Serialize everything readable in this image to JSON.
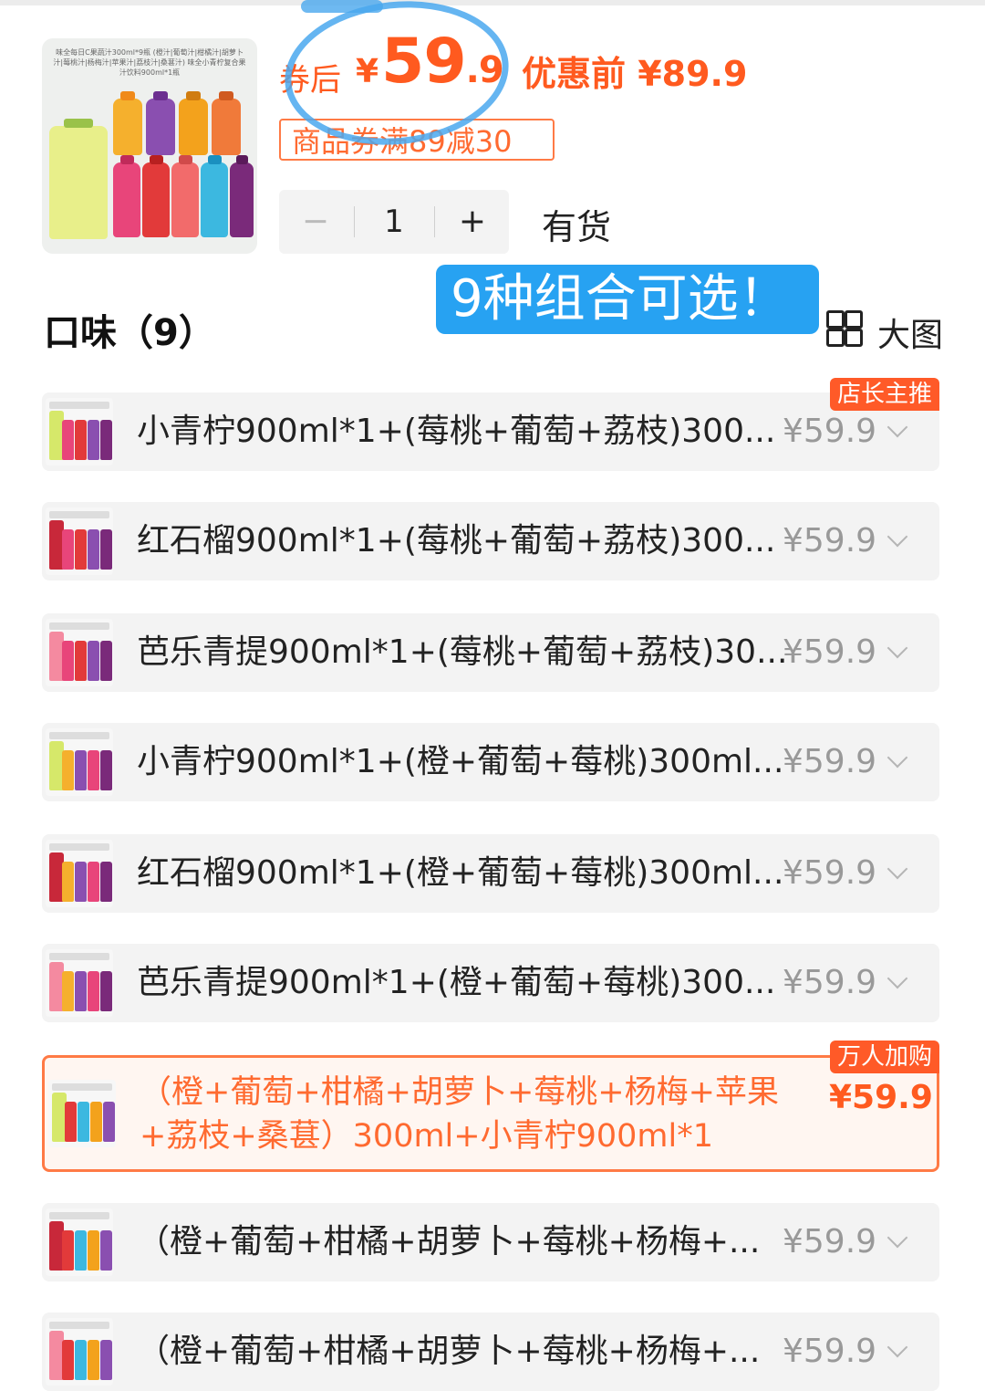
{
  "product": {
    "thumb_caption": "味全每日C果蔬汁300ml*9瓶 (橙汁|葡萄汁|柑橘汁|胡萝卜汁|莓桃汁|杨梅汁|苹果汁|荔枝汁|桑葚汁) 味全小青柠复合果汁饮料900ml*1瓶",
    "after_label": "券后",
    "after_currency": "¥",
    "after_price_int": "59",
    "after_price_dec": ".9",
    "before_label": "优惠前 ¥89.9",
    "coupon": "商品券满89减30",
    "quantity": "1",
    "minus": "−",
    "plus": "+",
    "stock": "有货"
  },
  "promo_banner": "9种组合可选！",
  "flavor": {
    "title": "口味（9）",
    "bigview_label": "大图"
  },
  "options": [
    {
      "label": "小青柠900ml*1+(莓桃+葡萄+荔枝)300...",
      "price": "¥59.9",
      "badge": "店长主推"
    },
    {
      "label": "红石榴900ml*1+(莓桃+葡萄+荔枝)300...",
      "price": "¥59.9",
      "badge": ""
    },
    {
      "label": "芭乐青提900ml*1+(莓桃+葡萄+荔枝)30...",
      "price": "¥59.9",
      "badge": ""
    },
    {
      "label": "小青柠900ml*1+(橙+葡萄+莓桃)300ml...",
      "price": "¥59.9",
      "badge": ""
    },
    {
      "label": "红石榴900ml*1+(橙+葡萄+莓桃)300ml...",
      "price": "¥59.9",
      "badge": ""
    },
    {
      "label": "芭乐青提900ml*1+(橙+葡萄+莓桃)300...",
      "price": "¥59.9",
      "badge": ""
    },
    {
      "label": "（橙+葡萄+柑橘+胡萝卜+莓桃+杨梅+苹果+荔枝+桑葚）300ml+小青柠900ml*1",
      "price": "¥59.9",
      "badge": "万人加购"
    },
    {
      "label": "（橙+葡萄+柑橘+胡萝卜+莓桃+杨梅+...",
      "price": "¥59.9",
      "badge": ""
    },
    {
      "label": "（橙+葡萄+柑橘+胡萝卜+莓桃+杨梅+...",
      "price": "¥59.9",
      "badge": ""
    }
  ],
  "colors": {
    "accent": "#ff5a1f",
    "banner": "#27a2f2",
    "circle": "#4aa8ee"
  }
}
